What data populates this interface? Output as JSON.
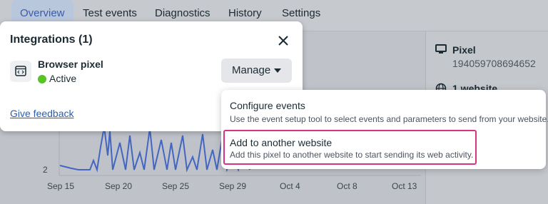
{
  "tabs": [
    "Overview",
    "Test events",
    "Diagnostics",
    "History",
    "Settings"
  ],
  "side": {
    "pixel_title": "Pixel",
    "pixel_id": "194059708694652",
    "website_title": "1 website"
  },
  "chart_data": {
    "type": "line",
    "x": [
      "Sep 15",
      "Sep 20",
      "Sep 25",
      "Sep 29",
      "Oct 4",
      "Oct 8",
      "Oct 13"
    ],
    "y_tick_visible": "2",
    "colors": {
      "line": "#4466c0"
    }
  },
  "dialog": {
    "title": "Integrations (1)",
    "integration_name": "Browser pixel",
    "status": "Active",
    "manage_label": "Manage",
    "feedback_link": "Give feedback"
  },
  "menu": {
    "items": [
      {
        "title": "Configure events",
        "description": "Use the event setup tool to select events and parameters to send from your website."
      },
      {
        "title": "Add to another website",
        "description": "Add this pixel to another website to start sending its web activity."
      }
    ]
  },
  "colors": {
    "accent": "#3b5aa8",
    "status_active": "#58c322",
    "highlight": "#d63384",
    "link": "#2a5db0"
  },
  "icons": [
    "close-icon",
    "code-window-icon",
    "monitor-icon",
    "globe-icon",
    "caret-down-icon"
  ]
}
